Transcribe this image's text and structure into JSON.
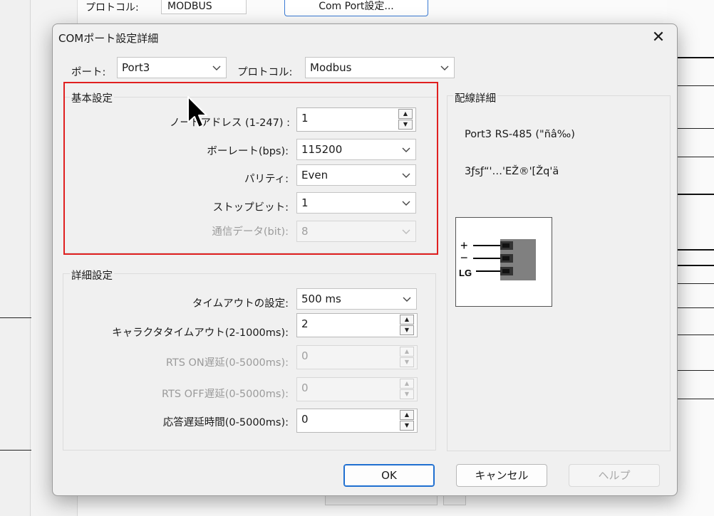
{
  "background": {
    "protocol_label": "プロトコル:",
    "protocol_value": "MODBUS",
    "com_port_button": "Com Port設定..."
  },
  "dialog": {
    "title": "COMポート設定詳細",
    "close": "✕",
    "port_label": "ポート:",
    "port_value": "Port3",
    "protocol_label": "プロトコル:",
    "protocol_value": "Modbus"
  },
  "basic": {
    "title": "基本設定",
    "node_address_label": "ノードアドレス (1-247) :",
    "node_address_value": "1",
    "baud_label": "ボーレート(bps):",
    "baud_value": "115200",
    "parity_label": "パリティ:",
    "parity_value": "Even",
    "stopbit_label": "ストップビット:",
    "stopbit_value": "1",
    "databits_label": "通信データ(bit):",
    "databits_value": "8"
  },
  "advanced": {
    "title": "詳細設定",
    "timeout_label": "タイムアウトの設定:",
    "timeout_value": "500 ms",
    "char_timeout_label": "キャラクタタイムアウト(2-1000ms):",
    "char_timeout_value": "2",
    "rts_on_label": "RTS ON遅延(0-5000ms):",
    "rts_on_value": "0",
    "rts_off_label": "RTS OFF遅延(0-5000ms):",
    "rts_off_value": "0",
    "resp_delay_label": "応答遅延時間(0-5000ms):",
    "resp_delay_value": "0"
  },
  "wiring": {
    "title": "配線詳細",
    "line1": "Port3  RS-485 (\"ñâ‰)",
    "line2": "3ƒsƒ“'…'EŽ®'[Žq'ä",
    "plus": "+",
    "minus": "−",
    "lg": "LG"
  },
  "buttons": {
    "ok": "OK",
    "cancel": "キャンセル",
    "help": "ヘルプ"
  },
  "colors": {
    "highlight": "#e02020",
    "primary_border": "#1f6fd0",
    "terminal_block": "#808080"
  }
}
